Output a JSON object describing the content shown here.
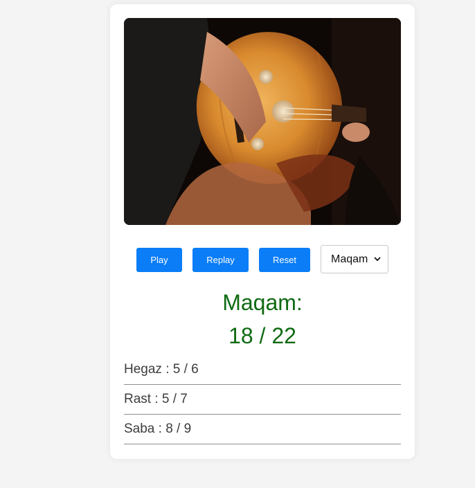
{
  "photo": {
    "alt": "Musician playing an oud"
  },
  "controls": {
    "play_label": "Play",
    "replay_label": "Replay",
    "reset_label": "Reset",
    "select": {
      "selected": "Maqam",
      "options": [
        "Maqam"
      ]
    }
  },
  "quiz": {
    "title": "Maqam:",
    "score": "18 / 22"
  },
  "results": [
    {
      "label": "Hegaz : 5 / 6"
    },
    {
      "label": "Rast : 5 / 7"
    },
    {
      "label": "Saba : 8 / 9"
    }
  ],
  "colors": {
    "accent": "#0a7df7",
    "score_text": "#0f6a12",
    "page_bg": "#f4f4f4"
  }
}
